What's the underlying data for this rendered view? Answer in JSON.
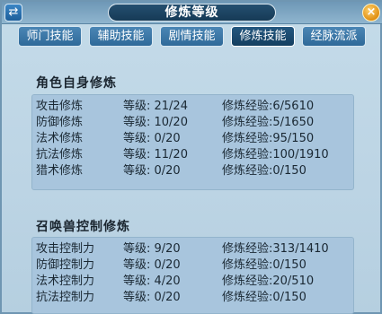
{
  "window": {
    "title": "修炼等级",
    "switch_icon": "⇄",
    "close_icon": "×"
  },
  "tabs": [
    {
      "label": "师门技能",
      "active": false
    },
    {
      "label": "辅助技能",
      "active": false
    },
    {
      "label": "剧情技能",
      "active": false
    },
    {
      "label": "修炼技能",
      "active": true
    },
    {
      "label": "经脉流派",
      "active": false
    }
  ],
  "sections": {
    "character": {
      "title": "角色自身修炼",
      "rows": [
        {
          "name": "攻击修炼",
          "level": "等级: 21/24",
          "exp": "修炼经验:6/5610"
        },
        {
          "name": "防御修炼",
          "level": "等级: 10/20",
          "exp": "修炼经验:5/1650"
        },
        {
          "name": "法术修炼",
          "level": "等级:  0/20",
          "exp": "修炼经验:95/150"
        },
        {
          "name": "抗法修炼",
          "level": "等级: 11/20",
          "exp": "修炼经验:100/1910"
        },
        {
          "name": "猎术修炼",
          "level": "等级:  0/20",
          "exp": "修炼经验:0/150"
        }
      ]
    },
    "summon": {
      "title": "召唤兽控制修炼",
      "rows": [
        {
          "name": "攻击控制力",
          "level": "等级:  9/20",
          "exp": "修炼经验:313/1410"
        },
        {
          "name": "防御控制力",
          "level": "等级:  0/20",
          "exp": "修炼经验:0/150"
        },
        {
          "name": "法术控制力",
          "level": "等级:  4/20",
          "exp": "修炼经验:20/510"
        },
        {
          "name": "抗法控制力",
          "level": "等级:  0/20",
          "exp": "修炼经验:0/150"
        }
      ]
    }
  }
}
